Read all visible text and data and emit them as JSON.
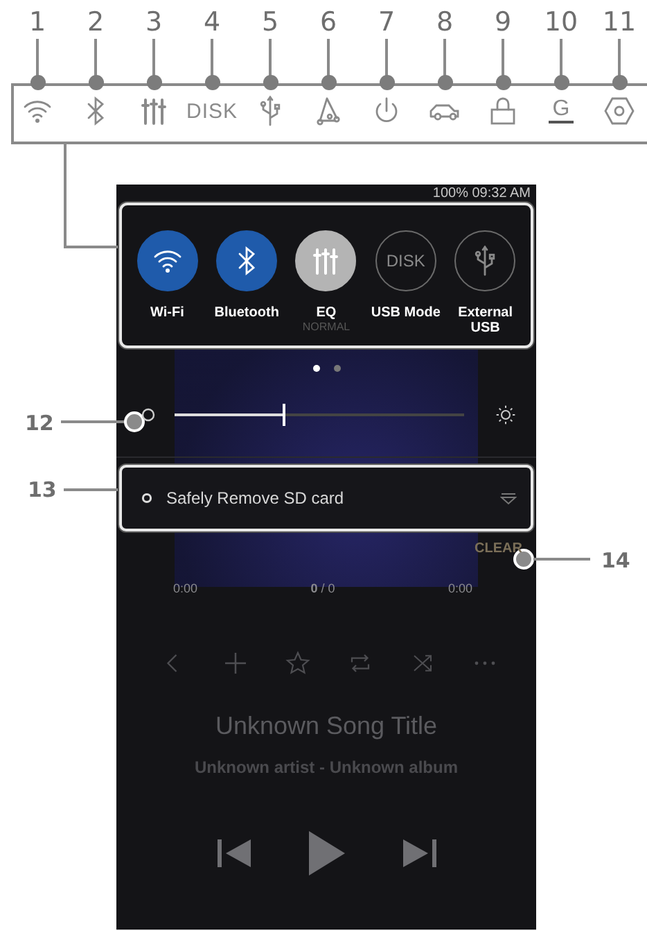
{
  "legend": [
    {
      "number": "1",
      "kind": "wifi"
    },
    {
      "number": "2",
      "kind": "bluetooth"
    },
    {
      "number": "3",
      "kind": "eq"
    },
    {
      "number": "4",
      "kind": "text",
      "text": "DISK"
    },
    {
      "number": "5",
      "kind": "usb"
    },
    {
      "number": "6",
      "kind": "network"
    },
    {
      "number": "7",
      "kind": "power"
    },
    {
      "number": "8",
      "kind": "car"
    },
    {
      "number": "9",
      "kind": "lock"
    },
    {
      "number": "10",
      "kind": "gain",
      "text": "G"
    },
    {
      "number": "11",
      "kind": "hex"
    }
  ],
  "status_bar": {
    "text": "100% 09:32 AM"
  },
  "quick_toggles": [
    {
      "label": "Wi-Fi",
      "kind": "wifi",
      "on": true,
      "color": "#1f5bab"
    },
    {
      "label": "Bluetooth",
      "kind": "bluetooth",
      "on": true,
      "color": "#1f5bab"
    },
    {
      "label": "EQ",
      "sublabel": "NORMAL",
      "kind": "eq",
      "on": true,
      "color": "#b4b4b4"
    },
    {
      "label": "USB Mode",
      "kind": "disk",
      "icon_text": "DISK",
      "on": false
    },
    {
      "label": "External USB",
      "kind": "usb",
      "on": false
    }
  ],
  "pager": [
    {
      "selected": true
    },
    {
      "selected": false
    }
  ],
  "brightness": {
    "level": 0.38
  },
  "notification": {
    "text": "Safely Remove SD card"
  },
  "clear_button": "CLEAR",
  "player": {
    "elapsed": "0:00",
    "counter": "**0** / 0",
    "total": "0:00",
    "title": "Unknown Song Title",
    "subtitle": "Unknown artist - Unknown album"
  },
  "callouts": {
    "brightness": "12",
    "notification": "13",
    "clear": "14"
  }
}
